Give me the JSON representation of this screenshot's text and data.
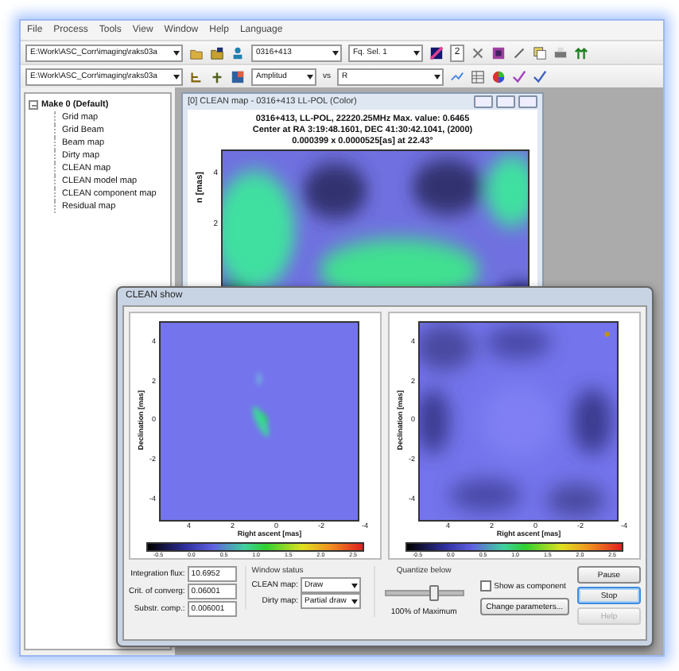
{
  "menu": [
    "File",
    "Process",
    "Tools",
    "View",
    "Window",
    "Help",
    "Language"
  ],
  "toolbar1": {
    "path": "E:\\Work\\ASC_Corr\\imaging\\raks03a",
    "source": "0316+413",
    "freq": "Fq. Sel. 1",
    "number": "2"
  },
  "toolbar2": {
    "path": "E:\\Work\\ASC_Corr\\imaging\\raks03a",
    "yaxis": "Amplitud",
    "vs": "vs",
    "xaxis": "R"
  },
  "tree": {
    "label": "Make 0 (Default)",
    "expanded": true,
    "children": [
      {
        "label": "Grid map",
        "selected": false
      },
      {
        "label": "Grid Beam",
        "selected": false
      },
      {
        "label": "Beam map",
        "selected": false
      },
      {
        "label": "Dirty map",
        "selected": false
      },
      {
        "label": "CLEAN map",
        "selected": false
      },
      {
        "label": "CLEAN model map",
        "selected": false
      },
      {
        "label": "CLEAN component map",
        "selected": false
      },
      {
        "label": "Residual map",
        "selected": false
      }
    ]
  },
  "map_window": {
    "title": "[0] CLEAN map - 0316+413 LL-POL  (Color)",
    "plot_title": [
      "0316+413, LL-POL, 22220.25MHz Max. value: 0.6465",
      "Center at RA 3:19:48.1601, DEC 41:30:42.1041, (2000)",
      "0.000399 x 0.0000525[as] at 22.43°"
    ],
    "yticks": [
      "4",
      "2"
    ],
    "ylabel": "n [mas]"
  },
  "dialog": {
    "title": "CLEAN show",
    "plots": [
      {
        "kind": "model",
        "ylabel": "Declination [mas]",
        "xlabel": "Right ascent [mas]",
        "yticks": [
          "4",
          "2",
          "0",
          "-2",
          "-4"
        ],
        "xticks": [
          "4",
          "2",
          "0",
          "-2",
          "-4"
        ],
        "colorbar_ticks": [
          "-0.5",
          "0.0",
          "0.5",
          "1.0",
          "1.5",
          "2.0",
          "2.5"
        ]
      },
      {
        "kind": "residual",
        "ylabel": "Declination [mas]",
        "xlabel": "Right ascent [mas]",
        "yticks": [
          "4",
          "2",
          "0",
          "-2",
          "-4"
        ],
        "xticks": [
          "4",
          "2",
          "0",
          "-2",
          "-4"
        ],
        "colorbar_ticks": [
          "-0.5",
          "0.0",
          "0.5",
          "1.0",
          "1.5",
          "2.0",
          "2.5"
        ]
      }
    ],
    "fields": [
      {
        "label": "Integration flux:",
        "value": "10.6952"
      },
      {
        "label": "Crit. of converg:",
        "value": "0.06001"
      },
      {
        "label": "Substr. comp.:",
        "value": "0.006001"
      }
    ],
    "window_status": {
      "title": "Window status",
      "rows": [
        {
          "label": "CLEAN map:",
          "value": "Draw"
        },
        {
          "label": "Dirty map:",
          "value": "Partial draw"
        }
      ]
    },
    "quantize": {
      "title": "Quantize below",
      "level": 0.62,
      "reading": "100% of Maximum"
    },
    "show_component": {
      "label": "Show as component",
      "checked": false
    },
    "buttons": [
      {
        "label": "Pause",
        "disabled": false,
        "focused": false
      },
      {
        "label": "Stop",
        "disabled": false,
        "focused": true
      },
      {
        "label": "Help",
        "disabled": true,
        "focused": false
      }
    ],
    "change_button": "Change parameters..."
  }
}
